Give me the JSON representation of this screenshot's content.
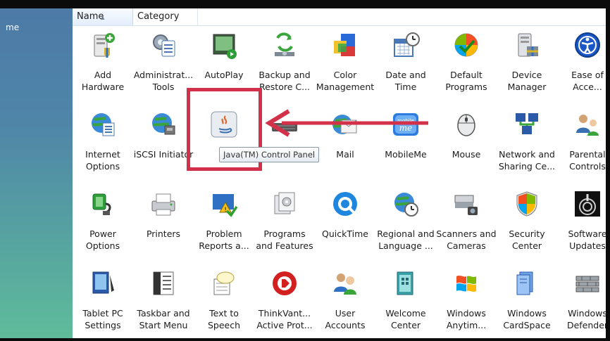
{
  "left_pane": {
    "crumb": "me"
  },
  "header": {
    "name_col": "Name",
    "category_col": "Category"
  },
  "tooltip": "Java(TM) Control Panel",
  "items": [
    {
      "name": "add-hardware",
      "l1": "Add",
      "l2": "Hardware",
      "icon": "hardware-icon"
    },
    {
      "name": "administrative-tools",
      "l1": "Administrat...",
      "l2": "Tools",
      "icon": "admin-tools-icon"
    },
    {
      "name": "autoplay",
      "l1": "AutoPlay",
      "l2": "",
      "icon": "autoplay-icon"
    },
    {
      "name": "backup-restore",
      "l1": "Backup and",
      "l2": "Restore C...",
      "icon": "backup-icon"
    },
    {
      "name": "color-management",
      "l1": "Color",
      "l2": "Management",
      "icon": "color-icon"
    },
    {
      "name": "date-time",
      "l1": "Date and",
      "l2": "Time",
      "icon": "calendar-clock-icon"
    },
    {
      "name": "default-programs",
      "l1": "Default",
      "l2": "Programs",
      "icon": "default-programs-icon"
    },
    {
      "name": "device-manager",
      "l1": "Device",
      "l2": "Manager",
      "icon": "device-manager-icon"
    },
    {
      "name": "ease-of-access",
      "l1": "Ease of",
      "l2": "Acce...",
      "icon": "ease-of-access-icon"
    },
    {
      "name": "internet-options",
      "l1": "Internet",
      "l2": "Options",
      "icon": "globe-list-icon"
    },
    {
      "name": "iscsi-initiator",
      "l1": "iSCSI Initiator",
      "l2": "",
      "icon": "globe-network-icon"
    },
    {
      "name": "java",
      "l1": "J",
      "l2": "",
      "icon": "java-icon"
    },
    {
      "name": "keyboard",
      "l1": "",
      "l2": "",
      "icon": "keyboard-icon"
    },
    {
      "name": "mail",
      "l1": "Mail",
      "l2": "",
      "icon": "mail-icon"
    },
    {
      "name": "mobileme",
      "l1": "MobileMe",
      "l2": "",
      "icon": "mobileme-icon"
    },
    {
      "name": "mouse",
      "l1": "Mouse",
      "l2": "",
      "icon": "mouse-icon"
    },
    {
      "name": "network-sharing",
      "l1": "Network and",
      "l2": "Sharing Ce...",
      "icon": "network-icon"
    },
    {
      "name": "parental-controls",
      "l1": "Parental",
      "l2": "Controls",
      "icon": "parental-icon"
    },
    {
      "name": "power-options",
      "l1": "Power",
      "l2": "Options",
      "icon": "power-plug-icon"
    },
    {
      "name": "printers",
      "l1": "Printers",
      "l2": "",
      "icon": "printer-icon"
    },
    {
      "name": "problem-reports",
      "l1": "Problem",
      "l2": "Reports a...",
      "icon": "problem-reports-icon"
    },
    {
      "name": "programs-features",
      "l1": "Programs",
      "l2": "and Features",
      "icon": "programs-icon"
    },
    {
      "name": "quicktime",
      "l1": "QuickTime",
      "l2": "",
      "icon": "quicktime-icon"
    },
    {
      "name": "regional-language",
      "l1": "Regional and",
      "l2": "Language ...",
      "icon": "globe-clock-icon"
    },
    {
      "name": "scanners-cameras",
      "l1": "Scanners and",
      "l2": "Cameras",
      "icon": "scanner-icon"
    },
    {
      "name": "security-center",
      "l1": "Security",
      "l2": "Center",
      "icon": "shield-icon"
    },
    {
      "name": "software-updates",
      "l1": "Software",
      "l2": "Updates",
      "icon": "software-update-icon"
    },
    {
      "name": "tablet-pc-settings",
      "l1": "Tablet PC",
      "l2": "Settings",
      "icon": "tablet-icon"
    },
    {
      "name": "taskbar-start-menu",
      "l1": "Taskbar and",
      "l2": "Start Menu",
      "icon": "taskbar-icon"
    },
    {
      "name": "text-to-speech",
      "l1": "Text to",
      "l2": "Speech",
      "icon": "speech-icon"
    },
    {
      "name": "thinkvantage",
      "l1": "ThinkVant...",
      "l2": "Active Prot...",
      "icon": "thinkvantage-icon"
    },
    {
      "name": "user-accounts",
      "l1": "User",
      "l2": "Accounts",
      "icon": "users-icon"
    },
    {
      "name": "welcome-center",
      "l1": "Welcome",
      "l2": "Center",
      "icon": "welcome-icon"
    },
    {
      "name": "windows-anytime",
      "l1": "Windows",
      "l2": "Anytim...",
      "icon": "windows-flag-icon"
    },
    {
      "name": "windows-cardspace",
      "l1": "Windows",
      "l2": "CardSpace",
      "icon": "cardspace-icon"
    },
    {
      "name": "windows-defender",
      "l1": "Windows",
      "l2": "Defender",
      "icon": "defender-icon"
    }
  ]
}
